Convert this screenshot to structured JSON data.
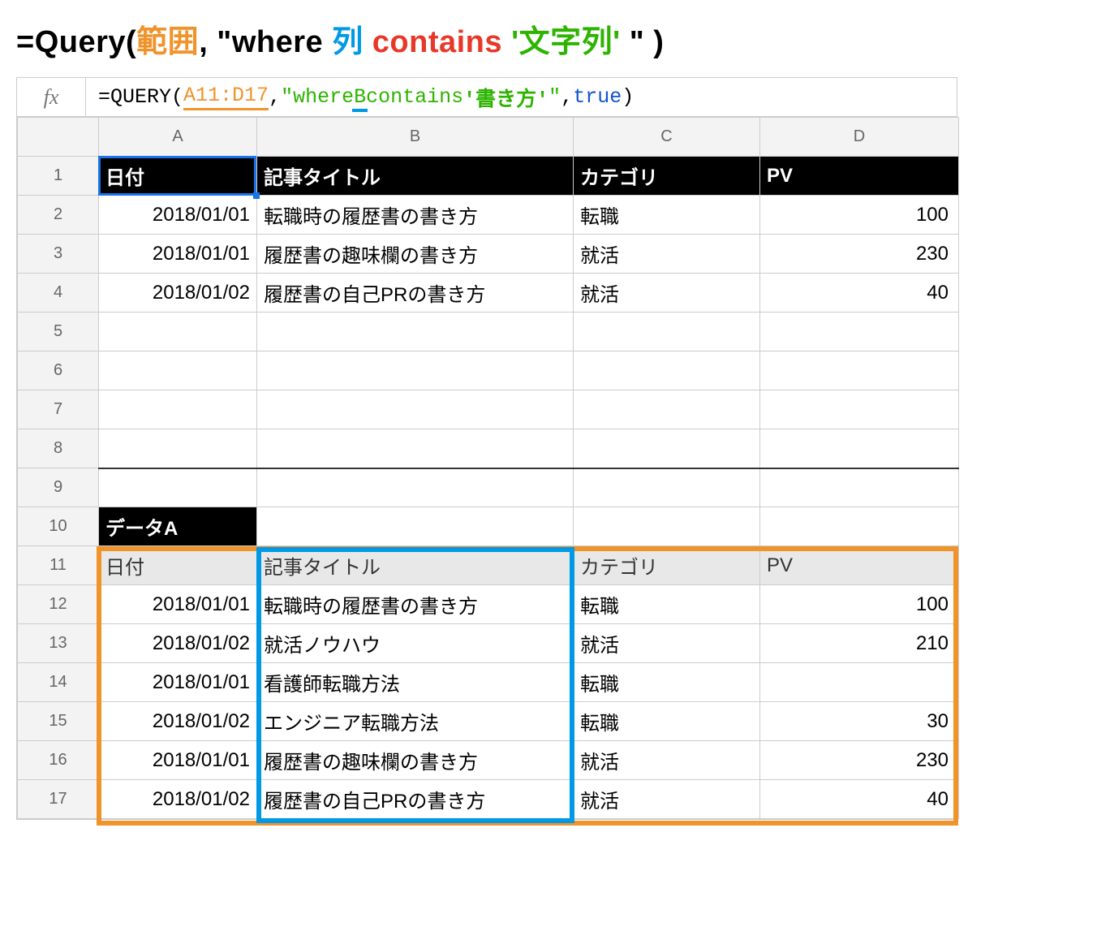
{
  "title": {
    "eq": "=Query(",
    "range": "範囲",
    "comma1": ", \"where ",
    "col": "列",
    "contains": " contains ",
    "strlit": "'文字列'",
    "end": " \" )"
  },
  "fx": "fx",
  "formula": {
    "start": "=QUERY(",
    "range": "A11:D17",
    "c1": ",",
    "q1": "\"where ",
    "col": "B",
    "q2": " contains ",
    "lit": "'書き方'",
    "q3": "\"",
    "c2": ",",
    "bool": "true",
    "end": ")"
  },
  "colHeaders": [
    "A",
    "B",
    "C",
    "D"
  ],
  "rowHeaders": [
    "1",
    "2",
    "3",
    "4",
    "5",
    "6",
    "7",
    "8",
    "9",
    "10",
    "11",
    "12",
    "13",
    "14",
    "15",
    "16",
    "17"
  ],
  "resultHeader": [
    "日付",
    "記事タイトル",
    "カテゴリ",
    "PV"
  ],
  "resultRows": [
    [
      "2018/01/01",
      "転職時の履歴書の書き方",
      "転職",
      "100"
    ],
    [
      "2018/01/01",
      "履歴書の趣味欄の書き方",
      "就活",
      "230"
    ],
    [
      "2018/01/02",
      "履歴書の自己PRの書き方",
      "就活",
      "40"
    ]
  ],
  "dataALabel": "データA",
  "dataAHeader": [
    "日付",
    "記事タイトル",
    "カテゴリ",
    "PV"
  ],
  "dataARows": [
    [
      "2018/01/01",
      "転職時の履歴書の書き方",
      "転職",
      "100"
    ],
    [
      "2018/01/02",
      "就活ノウハウ",
      "就活",
      "210"
    ],
    [
      "2018/01/01",
      "看護師転職方法",
      "転職",
      ""
    ],
    [
      "2018/01/02",
      "エンジニア転職方法",
      "転職",
      "30"
    ],
    [
      "2018/01/01",
      "履歴書の趣味欄の書き方",
      "就活",
      "230"
    ],
    [
      "2018/01/02",
      "履歴書の自己PRの書き方",
      "就活",
      "40"
    ]
  ]
}
